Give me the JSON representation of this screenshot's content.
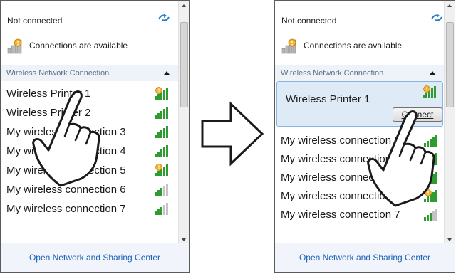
{
  "status": {
    "not_connected": "Not connected",
    "connections_available": "Connections are available"
  },
  "section": {
    "title": "Wireless Network Connection"
  },
  "networks_left": [
    {
      "name": "Wireless Printer 1",
      "signal": "warning"
    },
    {
      "name": "Wireless Printer 2",
      "signal": "full"
    },
    {
      "name": "My wireless connection 3",
      "signal": "full"
    },
    {
      "name": "My wireless connection 4",
      "signal": "full"
    },
    {
      "name": "My wireless connection 5",
      "signal": "warning"
    },
    {
      "name": "My wireless connection 6",
      "signal": "partial"
    },
    {
      "name": "My wireless connection 7",
      "signal": "partial"
    }
  ],
  "networks_right": [
    {
      "name": "My wireless connection 3",
      "signal": "full"
    },
    {
      "name": "My wireless connection 4",
      "signal": "full"
    },
    {
      "name": "My wireless connection 5",
      "signal": "full"
    },
    {
      "name": "My wireless connection 6",
      "signal": "warning"
    },
    {
      "name": "My wireless connection 7",
      "signal": "partial"
    }
  ],
  "selected": {
    "name": "Wireless Printer 1",
    "connect_label": "Connect"
  },
  "footer": {
    "link": "Open Network and Sharing Center"
  },
  "colors": {
    "accent_link": "#1a5fb4",
    "selected_bg": "#dfeaf7",
    "signal_green": "#2e9c2e"
  },
  "icons": {
    "refresh": "refresh-icon",
    "network": "network-bars-icon",
    "collapse": "chevron-up-icon",
    "arrow": "right-arrow-icon",
    "hand": "pointing-hand-icon"
  }
}
